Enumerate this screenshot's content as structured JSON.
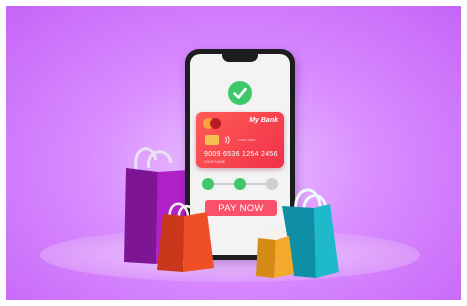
{
  "payment_screen": {
    "status_icon": "checkmark-icon",
    "card": {
      "bank_name": "My Bank",
      "card_number": "9009 6536 1254 2456",
      "valid_text": "VALID THRU",
      "holder_text": "YOUR NAME",
      "network_logo": "mastercard-logo",
      "chip_icon": "chip-icon",
      "contactless_icon": "contactless-icon",
      "color": "#f0314a"
    },
    "steps": {
      "total": 3,
      "completed": 2,
      "active_color": "#3fc86a",
      "inactive_color": "#cfcfd3"
    },
    "pay_button_label": "PAY NOW",
    "pay_button_color": "#f9506b"
  },
  "shopping_bags": [
    {
      "color": "#b020c8"
    },
    {
      "color": "#ef4f27"
    },
    {
      "color": "#f2a92c"
    },
    {
      "color": "#1fb9cc"
    }
  ]
}
